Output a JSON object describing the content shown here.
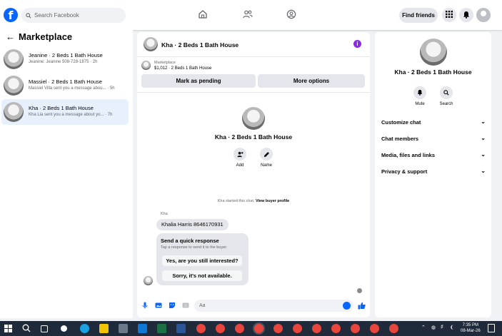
{
  "header": {
    "search_placeholder": "Search Facebook",
    "find_friends": "Find friends",
    "logo_letter": "f"
  },
  "sidebar": {
    "title": "Marketplace",
    "conversations": [
      {
        "title": "Jeanine · 2 Beds 1 Bath House",
        "preview": "Jeanine: Jeanine 508-728-1875 · 2h",
        "active": false
      },
      {
        "title": "Massiel · 2 Beds 1 Bath House",
        "preview": "Massiel Villa sent you a message abou... · 5h",
        "active": false
      },
      {
        "title": "Kha · 2 Beds 1 Bath House",
        "preview": "Kha Lia sent you a message about yo... · 7h",
        "active": true
      }
    ]
  },
  "chat": {
    "title": "Kha · 2 Beds 1 Bath House",
    "marketplace_label": "Marketplace",
    "listing": "$1,012 · 2 Beds 1 Bath House",
    "mark_pending": "Mark as pending",
    "more_options": "More options",
    "center_title": "Kha · 2 Beds 1 Bath House",
    "add_label": "Add",
    "name_label": "Name",
    "system_text": "Kha started this chat.",
    "view_profile": "View buyer profile",
    "sender_name": "Kha",
    "message": "Khalia Harris 8646170931",
    "quick_title": "Send a quick response",
    "quick_sub": "Tap a response to send it to the buyer.",
    "quick_replies": [
      "Yes, are you still interested?",
      "Sorry, it's not available."
    ],
    "input_placeholder": "Aa"
  },
  "details": {
    "title": "Kha · 2 Beds 1 Bath House",
    "mute": "Mute",
    "search": "Search",
    "sections": [
      "Customize chat",
      "Chat members",
      "Media, files and links",
      "Privacy & support"
    ]
  },
  "taskbar": {
    "time": "7:35 PM",
    "date": "08-Mar-26"
  },
  "colors": {
    "accent": "#0866ff",
    "info": "#8a2be2",
    "active_conv": "#e7f0fd"
  }
}
